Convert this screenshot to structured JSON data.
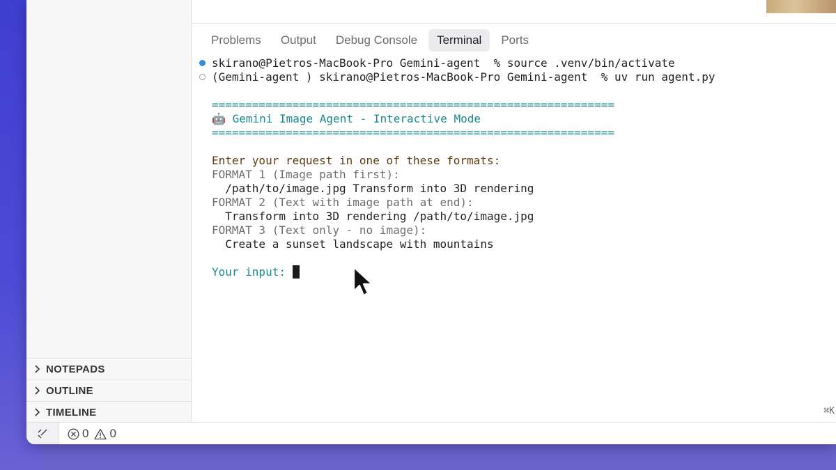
{
  "sidebar": {
    "sections": [
      {
        "label": "NOTEPADS"
      },
      {
        "label": "OUTLINE"
      },
      {
        "label": "TIMELINE"
      }
    ]
  },
  "panel": {
    "tabs": [
      {
        "label": "Problems"
      },
      {
        "label": "Output"
      },
      {
        "label": "Debug Console"
      },
      {
        "label": "Terminal",
        "active": true
      },
      {
        "label": "Ports"
      }
    ]
  },
  "terminal": {
    "cmd1": "skirano@Pietros-MacBook-Pro Gemini-agent  % source .venv/bin/activate",
    "cmd2": "(Gemini-agent ) skirano@Pietros-MacBook-Pro Gemini-agent  % uv run agent.py",
    "rule": "============================================================",
    "banner_icon": "robot-icon",
    "banner": "Gemini Image Agent - Interactive Mode",
    "prompt_heading": "Enter your request in one of these formats:",
    "format1": "FORMAT 1 (Image path first):",
    "example1": "  /path/to/image.jpg Transform into 3D rendering",
    "format2": "FORMAT 2 (Text with image path at end):",
    "example2": "  Transform into 3D rendering /path/to/image.jpg",
    "format3": "FORMAT 3 (Text only - no image):",
    "example3": "  Create a sunset landscape with mountains",
    "input_prompt": "Your input: ",
    "shortcut_hint": "⌘K"
  },
  "statusbar": {
    "errors": "0",
    "warnings": "0"
  },
  "colors": {
    "teal": "#1a8a8e",
    "prompt_brown": "#5c3b12",
    "dot_blue": "#2f8fd8",
    "background_purple": "#4a4fd0"
  }
}
